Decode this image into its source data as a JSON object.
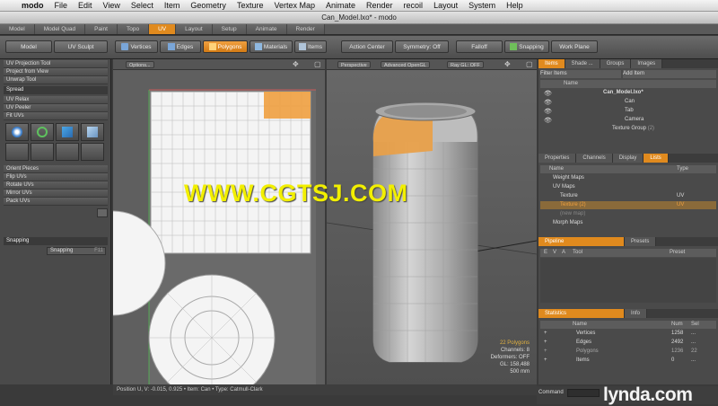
{
  "menubar": {
    "app": "modo",
    "items": [
      "File",
      "Edit",
      "View",
      "Select",
      "Item",
      "Geometry",
      "Texture",
      "Vertex Map",
      "Animate",
      "Render",
      "recoil",
      "Layout",
      "System",
      "Help"
    ]
  },
  "window_title": "Can_Model.lxo* - modo",
  "layout_tabs": [
    "Model",
    "Model Quad",
    "Paint",
    "Topo",
    "UV",
    "Layout",
    "Setup",
    "Animate",
    "Render"
  ],
  "layout_tab_active": "UV",
  "toolbar": {
    "model": "Model",
    "uv_sculpt": "UV Sculpt",
    "vertices": "Vertices",
    "edges": "Edges",
    "polygons": "Polygons",
    "materials": "Materials",
    "items": "Items",
    "action_center": "Action Center",
    "symmetry": "Symmetry: Off",
    "falloff": "Falloff",
    "snapping": "Snapping",
    "work_plane": "Work Plane"
  },
  "left_panel": {
    "tools": [
      "UV Projection Tool",
      "Project from View",
      "Unwrap Tool"
    ],
    "spread_header": "Spread",
    "spread_tools": [
      "UV Relax",
      "UV Peeler",
      "Fit UVs"
    ],
    "orient_tools": [
      "Orient Pieces",
      "Flip UVs",
      "Rotate UVs",
      "Mirror UVs",
      "Pack UVs"
    ],
    "snapping_header": "Snapping",
    "snapping_button": "Snapping",
    "snapping_key": "F11"
  },
  "uv_view": {
    "options": "Options..."
  },
  "view3d": {
    "perspective": "Perspective",
    "shading": "Advanced OpenGL",
    "raygl": "Ray GL: OFF",
    "stats": [
      "22 Polygons",
      "Channels: 8",
      "Deformers: OFF",
      "GL: 158,488",
      "500 mm"
    ]
  },
  "items_panel": {
    "tabs": [
      "Items",
      "Shade ...",
      "Groups",
      "Images"
    ],
    "filter": "Filter Items",
    "add_item": "Add Item",
    "col_name": "Name",
    "tree": [
      "Can_Model.lxo*",
      "Can",
      "Tab",
      "Camera",
      "Texture Group"
    ],
    "texture_group_count": "(2)"
  },
  "lists_panel": {
    "tabs": [
      "Properties",
      "Channels",
      "Display",
      "Lists"
    ],
    "col_name": "Name",
    "col_type": "Type",
    "rows": [
      {
        "name": "Weight Maps",
        "type": ""
      },
      {
        "name": "UV Maps",
        "type": ""
      },
      {
        "name": "Texture",
        "type": "UV"
      },
      {
        "name": "Texture (2)",
        "type": "UV"
      },
      {
        "name": "(new map)",
        "type": ""
      },
      {
        "name": "Morph Maps",
        "type": ""
      }
    ]
  },
  "pipeline_panel": {
    "tabs": [
      "Pipeline",
      "Presets"
    ],
    "cols": [
      "E",
      "V",
      "A",
      "Tool",
      "Preset"
    ]
  },
  "stats_panel": {
    "tabs": [
      "Statistics",
      "Info"
    ],
    "cols": [
      "Name",
      "Num",
      "Sel"
    ],
    "rows": [
      {
        "name": "Vertices",
        "num": "1258",
        "sel": "..."
      },
      {
        "name": "Edges",
        "num": "2492",
        "sel": "..."
      },
      {
        "name": "Polygons",
        "num": "1236",
        "sel": "22"
      },
      {
        "name": "Items",
        "num": "0",
        "sel": "..."
      }
    ]
  },
  "statusbar": "Position U, V: -0.015, 0.925 • Item: Can • Type: Catmull-Clark",
  "command_label": "Command",
  "watermark": "WWW.CGTSJ.COM",
  "brand": "lynda.com",
  "colors": {
    "accent": "#e08a1e",
    "selection": "#f0a040",
    "watermark": "#f2ef00"
  }
}
